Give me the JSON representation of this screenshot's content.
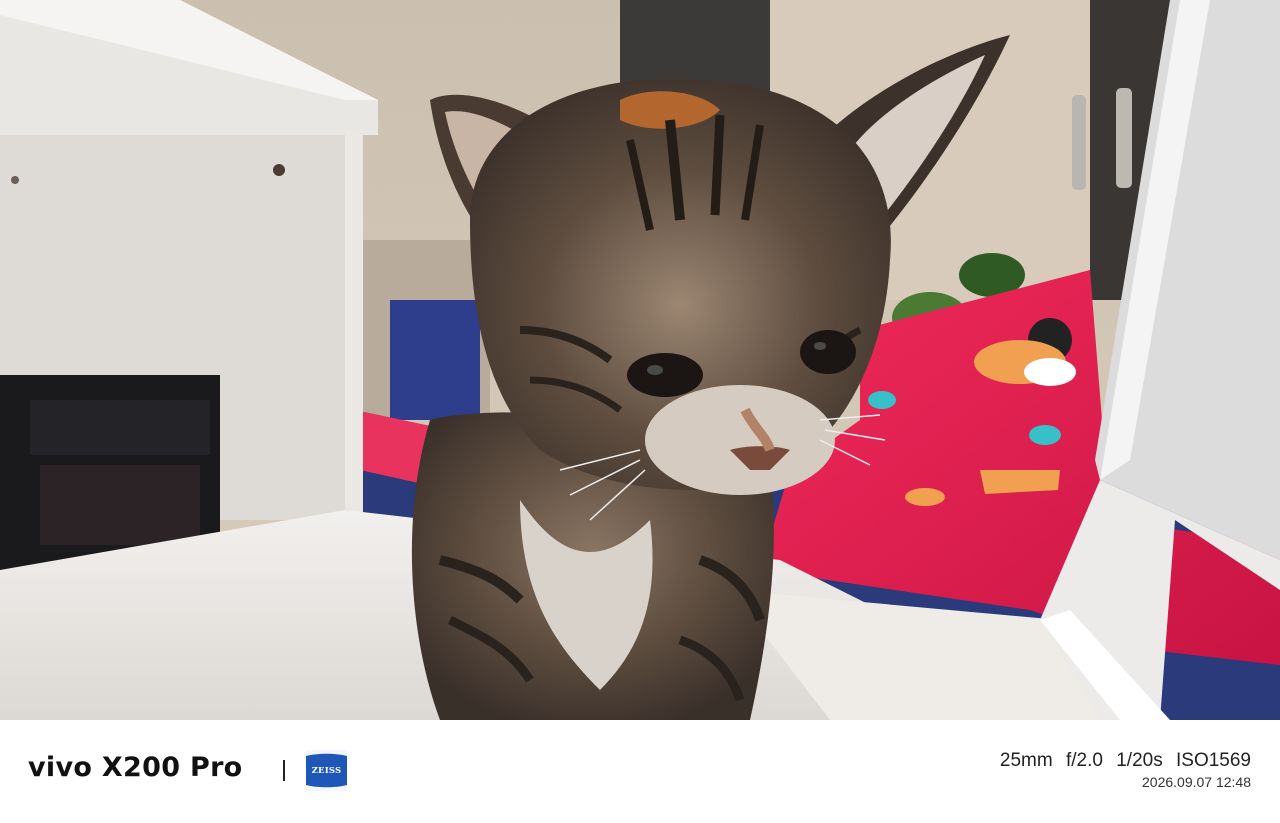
{
  "footer": {
    "brand": "vivo X200 Pro",
    "logo_text": "ZEISS",
    "focal_length": "25mm",
    "aperture": "f/2.0",
    "shutter": "1/20s",
    "iso": "ISO1569",
    "datetime": "2026.09.07 12:48"
  },
  "colors": {
    "zeiss_blue": "#1f57b8",
    "blanket_red": "#e0204f",
    "shelf_white": "#ece9e5",
    "wall_beige": "#d7cab8"
  },
  "photo": {
    "subject": "tabby kitten"
  }
}
